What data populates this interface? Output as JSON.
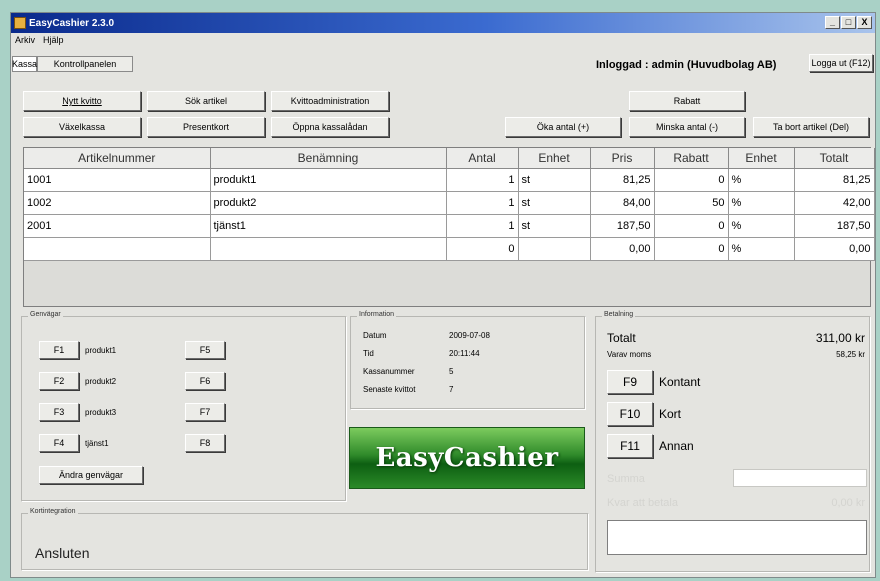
{
  "window": {
    "title": "EasyCashier 2.3.0",
    "controls": [
      "_",
      "□",
      "X"
    ]
  },
  "menu": [
    "Arkiv",
    "Hjälp"
  ],
  "tabs": [
    {
      "label": "Kassa",
      "active": true
    },
    {
      "label": "Kontrollpanelen",
      "active": false
    }
  ],
  "header": {
    "login_text": "Inloggad : admin (Huvudbolag AB)",
    "logout_label": "Logga ut (F12)"
  },
  "toolbar": {
    "new_receipt": "Nytt kvitto",
    "search_article": "Sök artikel",
    "receipt_admin": "Kvittoadministration",
    "discount": "Rabatt",
    "change_register": "Växelkassa",
    "gift_card": "Presentkort",
    "open_drawer": "Öppna kassalådan",
    "increase_qty": "Öka antal (+)",
    "decrease_qty": "Minska antal (-)",
    "remove_article": "Ta bort artikel (Del)"
  },
  "table": {
    "columns": [
      "Artikelnummer",
      "Benämning",
      "Antal",
      "Enhet",
      "Pris",
      "Rabatt",
      "Enhet",
      "Totalt"
    ],
    "rows": [
      [
        "1001",
        "produkt1",
        "1",
        "st",
        "81,25",
        "0",
        "%",
        "81,25"
      ],
      [
        "1002",
        "produkt2",
        "1",
        "st",
        "84,00",
        "50",
        "%",
        "42,00"
      ],
      [
        "2001",
        "tjänst1",
        "1",
        "st",
        "187,50",
        "0",
        "%",
        "187,50"
      ],
      [
        "",
        "",
        "0",
        "",
        "0,00",
        "0",
        "%",
        "0,00"
      ]
    ]
  },
  "shortcuts": {
    "title": "Genvägar",
    "items": [
      {
        "key": "F1",
        "label": "produkt1"
      },
      {
        "key": "F2",
        "label": "produkt2"
      },
      {
        "key": "F3",
        "label": "produkt3"
      },
      {
        "key": "F4",
        "label": "tjänst1"
      },
      {
        "key": "F5",
        "label": ""
      },
      {
        "key": "F6",
        "label": ""
      },
      {
        "key": "F7",
        "label": ""
      },
      {
        "key": "F8",
        "label": ""
      }
    ],
    "change_label": "Ändra genvägar"
  },
  "information": {
    "title": "Information",
    "rows": [
      {
        "label": "Datum",
        "value": "2009-07-08"
      },
      {
        "label": "Tid",
        "value": "20:11:44"
      },
      {
        "label": "Kassanummer",
        "value": "5"
      },
      {
        "label": "Senaste kvittot",
        "value": "7"
      }
    ]
  },
  "logo_text": "EasyCashier",
  "card": {
    "title": "Kortintegration",
    "status": "Ansluten"
  },
  "payment": {
    "title": "Betalning",
    "total_label": "Totalt",
    "total_value": "311,00 kr",
    "vat_label": "Varav moms",
    "vat_value": "58,25 kr",
    "methods": [
      {
        "key": "F9",
        "label": "Kontant"
      },
      {
        "key": "F10",
        "label": "Kort"
      },
      {
        "key": "F11",
        "label": "Annan"
      }
    ],
    "sum_label": "Summa",
    "remaining_label": "Kvar att betala",
    "remaining_value": "0,00 kr"
  }
}
